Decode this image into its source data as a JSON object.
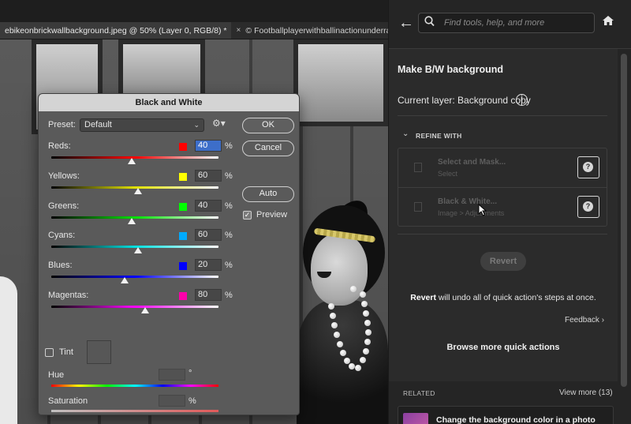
{
  "document_tabs": [
    {
      "label": "ebikeonbrickwallbackground.jpeg @ 50% (Layer 0, RGB/8) *",
      "active": true
    },
    {
      "label": "Footballplayerwithballinactionunderrai",
      "active": false,
      "close": "×",
      "icon": "©"
    }
  ],
  "dialog": {
    "title": "Black and White",
    "preset_label": "Preset:",
    "preset_value": "Default",
    "buttons": {
      "ok": "OK",
      "cancel": "Cancel",
      "auto": "Auto"
    },
    "preview_label": "Preview",
    "preview_checked": true,
    "sliders": [
      {
        "name": "Reds:",
        "value": "40",
        "unit": "%",
        "level": 40,
        "swatch": "#ff0000",
        "track": "linear-gradient(90deg,#000,#ff0000,#fff)",
        "selected": true
      },
      {
        "name": "Yellows:",
        "value": "60",
        "unit": "%",
        "level": 60,
        "swatch": "#ffff00",
        "track": "linear-gradient(90deg,#000,#e0e000,#fff)"
      },
      {
        "name": "Greens:",
        "value": "40",
        "unit": "%",
        "level": 40,
        "swatch": "#00ff00",
        "track": "linear-gradient(90deg,#000,#00e000,#fff)"
      },
      {
        "name": "Cyans:",
        "value": "60",
        "unit": "%",
        "level": 60,
        "swatch": "#00aaff",
        "track": "linear-gradient(90deg,#000,#00e0e0,#fff)"
      },
      {
        "name": "Blues:",
        "value": "20",
        "unit": "%",
        "level": 20,
        "swatch": "#0000ff",
        "track": "linear-gradient(90deg,#000,#0000ff,#fff)"
      },
      {
        "name": "Magentas:",
        "value": "80",
        "unit": "%",
        "level": 80,
        "swatch": "#ff00aa",
        "track": "linear-gradient(90deg,#000,#ff00ff,#fff)"
      }
    ],
    "tint_label": "Tint",
    "hue_label": "Hue",
    "hue_unit": "°",
    "saturation_label": "Saturation",
    "saturation_unit": "%"
  },
  "panel": {
    "search_placeholder": "Find tools, help, and more",
    "title": "Make B/W background",
    "current_layer": "Current layer: Background copy",
    "info_glyph": "i",
    "refine_label": "REFINE WITH",
    "steps": [
      {
        "title": "Select and Mask...",
        "subtitle": "Select"
      },
      {
        "title": "Black & White...",
        "subtitle": "Image > Adjustments"
      }
    ],
    "revert_label": "Revert",
    "revert_note_bold": "Revert",
    "revert_note_rest": " will undo all of quick action's steps at once.",
    "feedback_label": "Feedback",
    "browse_label": "Browse more quick actions",
    "related_label": "RELATED",
    "view_more": "View more (13)",
    "related_item": "Change the background color in a photo"
  }
}
